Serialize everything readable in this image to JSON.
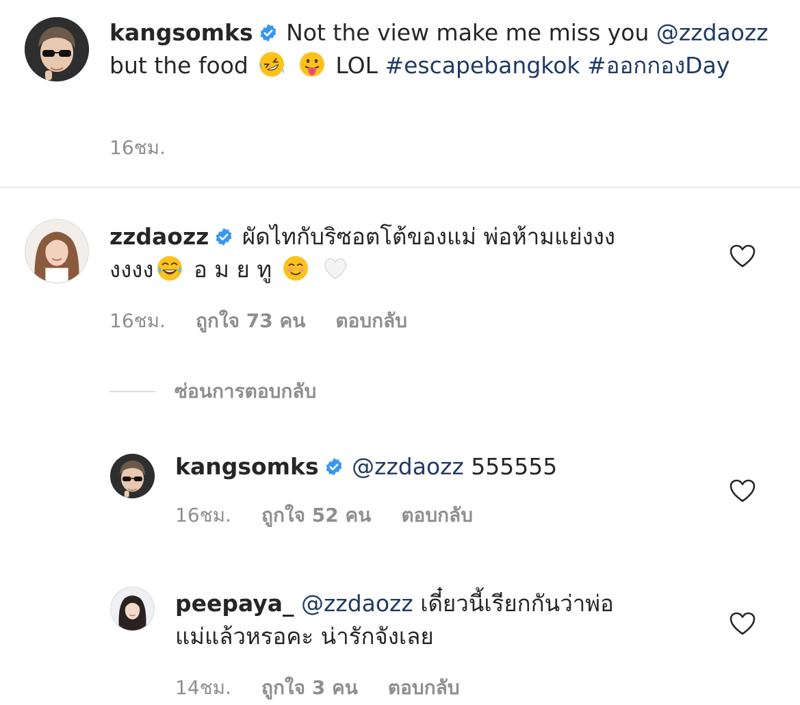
{
  "caption": {
    "username": "kangsomks",
    "text_1": "Not the view make me miss you",
    "mention": "@zzdaozz",
    "text_2": "but the food",
    "emoji_1": "rofl-emoji",
    "emoji_2": "tongue-emoji",
    "text_3": "LOL",
    "hashtag_1": "#escapebangkok",
    "hashtag_2": "#ออกกองDay",
    "time": "16ชม."
  },
  "comments": [
    {
      "username": "zzdaozz",
      "text_1": "ผัดไทกับริซอตโต้ของแม่ พ่อห้ามแย่งงง",
      "text_2": "งงงง",
      "emoji_1": "tears-of-joy-emoji",
      "text_3": "อ ม ย ทู",
      "emoji_2": "smiling-emoji",
      "emoji_3": "white-heart-emoji",
      "time": "16ชม.",
      "likes": "ถูกใจ 73 คน",
      "reply": "ตอบกลับ"
    }
  ],
  "hide_replies": "ซ่อนการตอบกลับ",
  "replies": [
    {
      "username": "kangsomks",
      "mention": "@zzdaozz",
      "text": "555555",
      "time": "16ชม.",
      "likes": "ถูกใจ 52 คน",
      "reply": "ตอบกลับ"
    },
    {
      "username": "peepaya_",
      "mention": "@zzdaozz",
      "text_1": "เดี๋ยวนี้เรียกกันว่าพ่อ",
      "text_2": "แม่แล้วหรอคะ  น่ารักจังเลย",
      "time": "14ชม.",
      "likes": "ถูกใจ 3 คน",
      "reply": "ตอบกลับ"
    }
  ],
  "colors": {
    "text": "#262626",
    "secondary": "#8e8e8e",
    "link": "#1f3a63",
    "verified": "#3897f0",
    "divider": "#dbdbdb"
  }
}
